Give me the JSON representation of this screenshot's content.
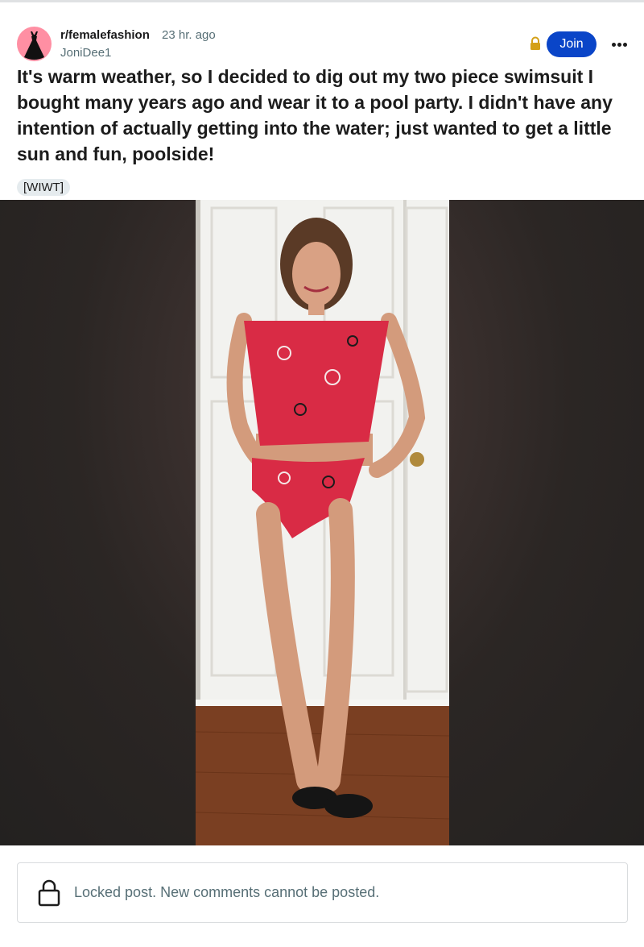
{
  "post": {
    "subreddit": "r/femalefashion",
    "time_ago": "23 hr. ago",
    "author": "JoniDee1",
    "join_label": "Join",
    "title": "It's warm weather, so I decided to dig out my two piece swimsuit I bought many years ago and wear it to a pool party. I didn't have any intention of actually getting into the water; just wanted to get a little sun and fun, poolside!",
    "flair": "[WIWT]"
  },
  "footer": {
    "locked_message": "Locked post. New comments cannot be posted."
  },
  "colors": {
    "join_button": "#0a45c8",
    "lock_badge": "#d4a017",
    "avatar_bg": "#ff8fa3",
    "swimsuit": "#d92b45"
  },
  "icons": [
    "subreddit-avatar-dress-icon",
    "lock-icon",
    "more-options-icon",
    "locked-post-lock-icon"
  ]
}
